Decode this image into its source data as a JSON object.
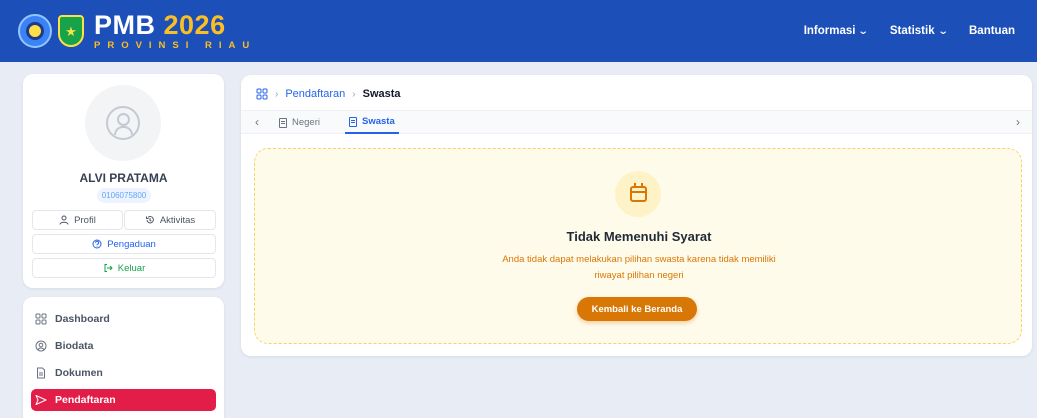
{
  "header": {
    "brand": "PMB",
    "year": "2026",
    "subtitle": "PROVINSI RIAU",
    "nav": [
      {
        "label": "Informasi"
      },
      {
        "label": "Statistik"
      },
      {
        "label": "Bantuan"
      }
    ]
  },
  "profile": {
    "name": "ALVI PRATAMA",
    "id": "0106075800",
    "buttons": {
      "profil": "Profil",
      "aktivitas": "Aktivitas",
      "pengaduan": "Pengaduan",
      "keluar": "Keluar"
    }
  },
  "sidebar": {
    "items": [
      {
        "label": "Dashboard",
        "icon": "grid-icon"
      },
      {
        "label": "Biodata",
        "icon": "user-circle-icon"
      },
      {
        "label": "Dokumen",
        "icon": "document-icon"
      },
      {
        "label": "Pendaftaran",
        "icon": "send-icon",
        "active": true
      }
    ]
  },
  "breadcrumb": {
    "parent": "Pendaftaran",
    "current": "Swasta"
  },
  "tabs": [
    {
      "label": "Negeri",
      "active": false
    },
    {
      "label": "Swasta",
      "active": true
    }
  ],
  "notice": {
    "title": "Tidak Memenuhi Syarat",
    "message": "Anda tidak dapat melakukan pilihan swasta karena tidak memiliki riwayat pilihan negeri",
    "button": "Kembali ke Beranda"
  },
  "colors": {
    "header": "#1d4fb8",
    "accent": "#d97706",
    "active_menu": "#e11d48",
    "link": "#2563eb"
  }
}
